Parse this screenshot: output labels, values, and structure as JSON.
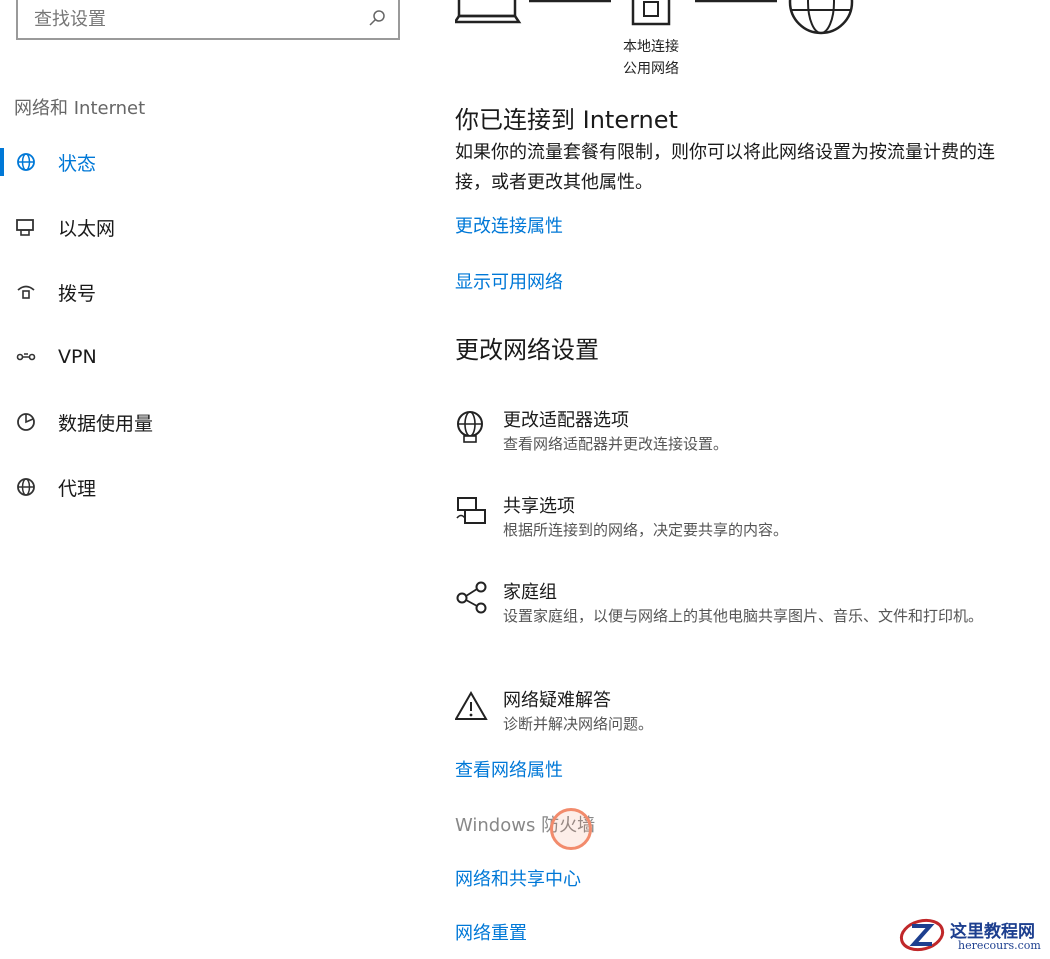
{
  "search": {
    "placeholder": "查找设置"
  },
  "sidebar": {
    "section_label": "网络和 Internet",
    "items": [
      {
        "label": "状态",
        "icon": "status-globe-icon",
        "active": true
      },
      {
        "label": "以太网",
        "icon": "ethernet-icon"
      },
      {
        "label": "拨号",
        "icon": "dialup-icon"
      },
      {
        "label": "VPN",
        "icon": "vpn-icon"
      },
      {
        "label": "数据使用量",
        "icon": "data-usage-icon"
      },
      {
        "label": "代理",
        "icon": "proxy-globe-icon"
      }
    ]
  },
  "diagram": {
    "connection_name": "本地连接",
    "network_type": "公用网络"
  },
  "main": {
    "connected_heading": "你已连接到 Internet",
    "connected_desc": "如果你的流量套餐有限制，则你可以将此网络设置为按流量计费的连接，或者更改其他属性。",
    "link_change_props": "更改连接属性",
    "link_show_networks": "显示可用网络",
    "change_heading": "更改网络设置",
    "options": [
      {
        "title": "更改适配器选项",
        "desc": "查看网络适配器并更改连接设置。",
        "icon": "adapter-globe-icon"
      },
      {
        "title": "共享选项",
        "desc": "根据所连接到的网络，决定要共享的内容。",
        "icon": "sharing-icon"
      },
      {
        "title": "家庭组",
        "desc": "设置家庭组，以便与网络上的其他电脑共享图片、音乐、文件和打印机。",
        "icon": "homegroup-icon"
      },
      {
        "title": "网络疑难解答",
        "desc": "诊断并解决网络问题。",
        "icon": "warning-icon"
      }
    ],
    "link_view_props": "查看网络属性",
    "link_firewall": "Windows 防火墙",
    "link_sharing_center": "网络和共享中心",
    "link_reset": "网络重置"
  },
  "watermark": {
    "title": "这里教程网",
    "url": "herecours.com"
  },
  "colors": {
    "accent": "#0078d7",
    "link": "#0078d7",
    "muted": "#555555"
  }
}
